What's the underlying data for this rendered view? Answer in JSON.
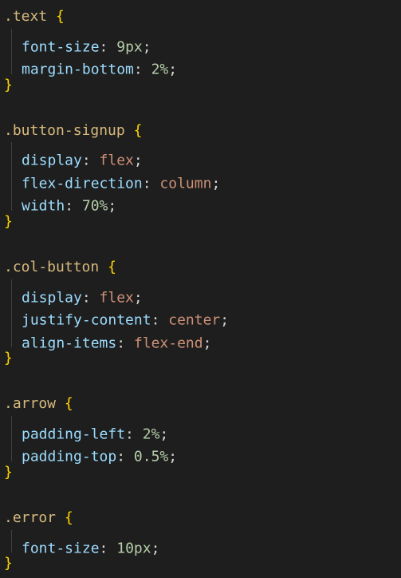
{
  "editor": {
    "lines": [
      {
        "type": "open",
        "selector": ".text",
        "brace": "{"
      },
      {
        "type": "decl",
        "prop": "font-size",
        "colon": ": ",
        "value": "9px",
        "value_kind": "num",
        "semi": ";"
      },
      {
        "type": "decl",
        "prop": "margin-bottom",
        "colon": ": ",
        "value": "2%",
        "value_kind": "num",
        "semi": ";"
      },
      {
        "type": "close",
        "brace": "}"
      },
      {
        "type": "blank"
      },
      {
        "type": "open",
        "selector": ".button-signup",
        "brace": "{"
      },
      {
        "type": "decl",
        "prop": "display",
        "colon": ": ",
        "value": "flex",
        "value_kind": "kw",
        "semi": ";"
      },
      {
        "type": "decl",
        "prop": "flex-direction",
        "colon": ": ",
        "value": "column",
        "value_kind": "kw",
        "semi": ";"
      },
      {
        "type": "decl",
        "prop": "width",
        "colon": ": ",
        "value": "70%",
        "value_kind": "num",
        "semi": ";"
      },
      {
        "type": "close",
        "brace": "}"
      },
      {
        "type": "blank"
      },
      {
        "type": "open",
        "selector": ".col-button",
        "brace": "{"
      },
      {
        "type": "decl",
        "prop": "display",
        "colon": ": ",
        "value": "flex",
        "value_kind": "kw",
        "semi": ";"
      },
      {
        "type": "decl",
        "prop": "justify-content",
        "colon": ": ",
        "value": "center",
        "value_kind": "kw",
        "semi": ";"
      },
      {
        "type": "decl",
        "prop": "align-items",
        "colon": ": ",
        "value": "flex-end",
        "value_kind": "kw",
        "semi": ";"
      },
      {
        "type": "close",
        "brace": "}"
      },
      {
        "type": "blank"
      },
      {
        "type": "open",
        "selector": ".arrow",
        "brace": "{"
      },
      {
        "type": "decl",
        "prop": "padding-left",
        "colon": ": ",
        "value": "2%",
        "value_kind": "num",
        "semi": ";"
      },
      {
        "type": "decl",
        "prop": "padding-top",
        "colon": ": ",
        "value": "0.5%",
        "value_kind": "num",
        "semi": ";"
      },
      {
        "type": "close",
        "brace": "}"
      },
      {
        "type": "blank"
      },
      {
        "type": "open",
        "selector": ".error",
        "brace": "{"
      },
      {
        "type": "decl",
        "prop": "font-size",
        "colon": ": ",
        "value": "10px",
        "value_kind": "num",
        "semi": ";"
      },
      {
        "type": "close",
        "brace": "}"
      }
    ]
  },
  "colors": {
    "background": "#1e1e1e",
    "selector": "#d7ba7d",
    "brace": "#ffd700",
    "property": "#9cdcfe",
    "number": "#b5cea8",
    "keyword": "#ce9178",
    "punctuation": "#d4d4d4",
    "indent_guide": "#404040"
  }
}
